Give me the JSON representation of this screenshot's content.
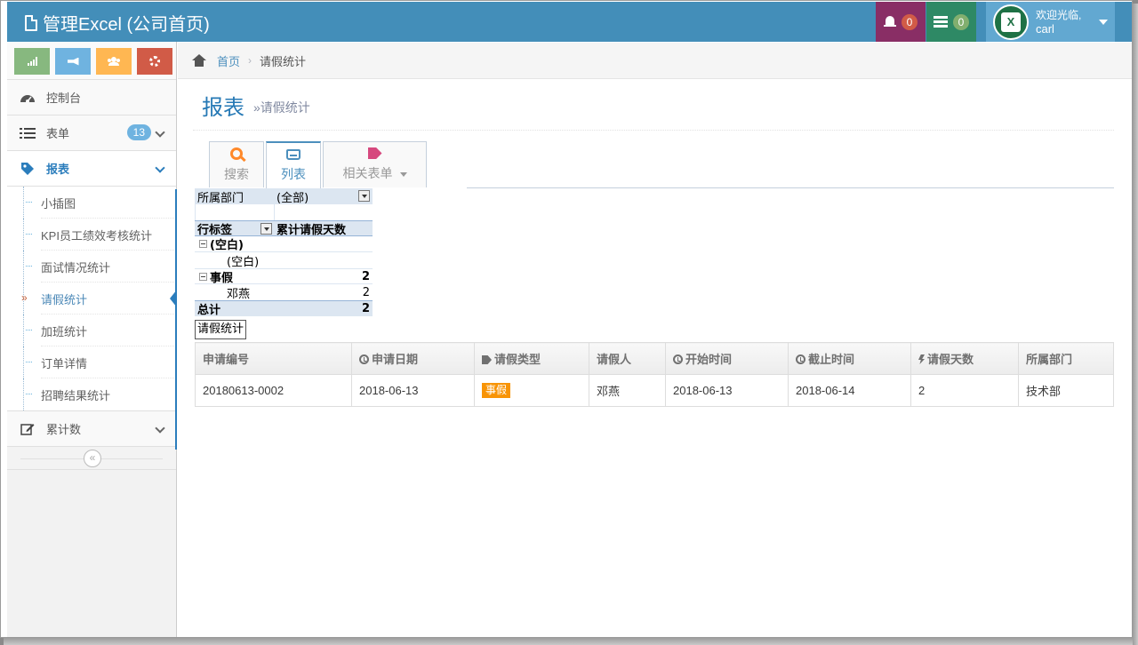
{
  "navbar": {
    "title": "管理Excel (公司首页)",
    "notifications_count": "0",
    "tasks_count": "0",
    "welcome": "欢迎光临,",
    "username": "carl"
  },
  "sidebar": {
    "menu": [
      {
        "label": "控制台",
        "icon": "dashboard-icon"
      },
      {
        "label": "表单",
        "icon": "list-icon",
        "badge": "13"
      },
      {
        "label": "报表",
        "icon": "tag-icon",
        "active": true
      },
      {
        "label": "累计数",
        "icon": "edit-icon"
      }
    ],
    "submenu": [
      "小插图",
      "KPI员工绩效考核统计",
      "面试情况统计",
      "请假统计",
      "加班统计",
      "订单详情",
      "招聘结果统计"
    ],
    "current_submenu": "请假统计"
  },
  "breadcrumb": {
    "home": "首页",
    "current": "请假统计"
  },
  "page_header": {
    "title": "报表",
    "subtitle": "»请假统计"
  },
  "tabs": [
    {
      "label": "搜索",
      "icon": "search-icon"
    },
    {
      "label": "列表",
      "icon": "inbox-icon",
      "active": true
    },
    {
      "label": "相关表单",
      "icon": "tags-icon",
      "dropdown": true
    }
  ],
  "pivot": {
    "filter_label": "所属部门",
    "filter_value": "(全部)",
    "row_label": "行标签",
    "value_label": "累计请假天数",
    "group1": "(空白)",
    "group1_item": "(空白)",
    "group2": "事假",
    "group2_value": "2",
    "group2_item": "邓燕",
    "group2_item_value": "2",
    "total_label": "总计",
    "total_value": "2",
    "sheet_label": "请假统计"
  },
  "table": {
    "columns": [
      "申请编号",
      "申请日期",
      "请假类型",
      "请假人",
      "开始时间",
      "截止时间",
      "请假天数",
      "所属部门"
    ],
    "rows": [
      [
        "20180613-0002",
        "2018-06-13",
        "事假",
        "邓燕",
        "2018-06-13",
        "2018-06-14",
        "2",
        "技术部"
      ]
    ]
  },
  "colors": {
    "navbar": "#438eb9",
    "accent": "#2b7dbc",
    "warning_label": "#f89406"
  }
}
